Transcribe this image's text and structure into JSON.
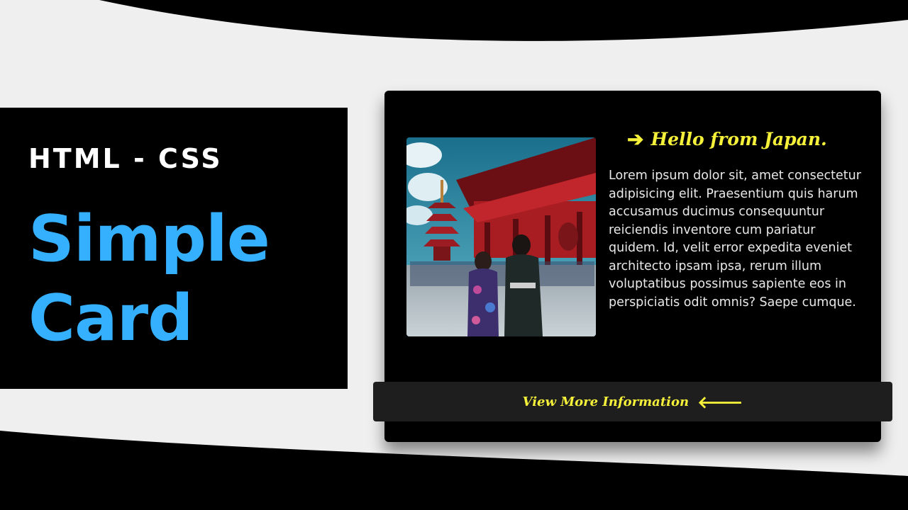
{
  "title_panel": {
    "subtitle": "HTML - CSS",
    "title_line1": "Simple",
    "title_line2": "Card"
  },
  "card": {
    "photo": {
      "icon": "japan-temple-photo"
    },
    "heading": "Hello from Japan.",
    "heading_icon": "arrow-right-icon",
    "body": "Lorem ipsum dolor sit, amet consectetur adipisicing elit. Praesentium quis harum accusamus ducimus consequuntur reiciendis inventore cum pariatur quidem. Id, velit error expedita eveniet architecto ipsam ipsa, rerum illum voluptatibus possimus sapiente eos in perspiciatis odit omnis? Saepe cumque.",
    "button_label": "View More Information",
    "button_icon": "arrow-left-icon"
  },
  "colors": {
    "accent_blue": "#35b0ff",
    "accent_yellow": "#f5f03a",
    "background": "#efefef",
    "card": "#000000",
    "button": "#1e1e1e"
  }
}
